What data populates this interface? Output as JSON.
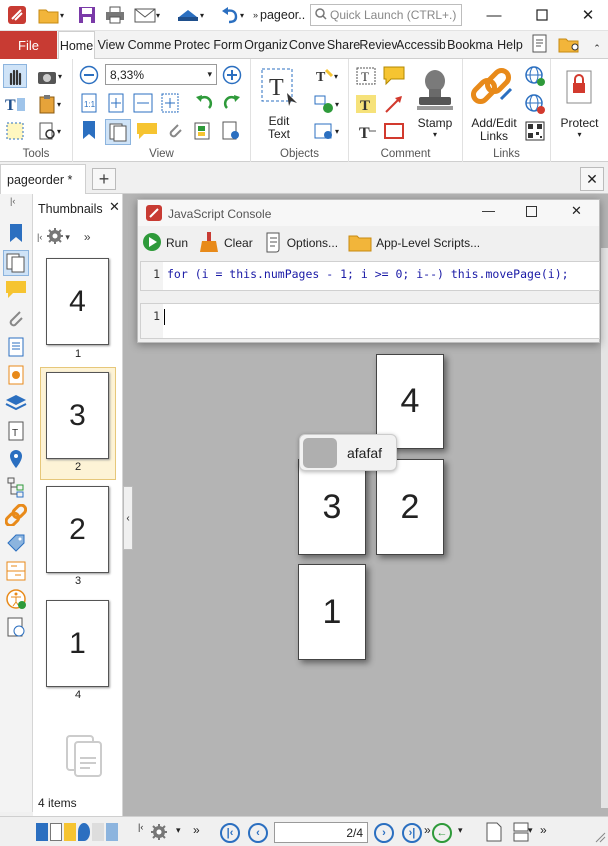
{
  "window": {
    "title": "pageor..",
    "search_placeholder": "Quick Launch (CTRL+.)"
  },
  "menu": {
    "file": "File",
    "tabs": [
      "Home",
      "View",
      "Comme",
      "Protec",
      "Form",
      "Organiz",
      "Conve",
      "Share",
      "Reviev",
      "Accessib",
      "Bookma",
      "Help"
    ]
  },
  "ribbon": {
    "zoom_value": "8,33%",
    "groups": {
      "tools": "Tools",
      "view": "View",
      "objects": "Objects",
      "comment": "Comment",
      "links": "Links"
    },
    "edit_text": "Edit\nText",
    "stamp": "Stamp",
    "add_edit_links": "Add/Edit\nLinks",
    "protect": "Protect"
  },
  "document_tab": {
    "label": "pageorder *"
  },
  "thumbnails": {
    "title": "Thumbnails",
    "items": [
      {
        "page_text": "4",
        "label": "1"
      },
      {
        "page_text": "3",
        "label": "2"
      },
      {
        "page_text": "2",
        "label": "3"
      },
      {
        "page_text": "1",
        "label": "4"
      }
    ],
    "count": "4 items"
  },
  "console": {
    "title": "JavaScript Console",
    "run": "Run",
    "clear": "Clear",
    "options": "Options...",
    "app_level": "App-Level Scripts...",
    "line1_no": "1",
    "code": "for (i = this.numPages - 1; i >= 0; i--) this.movePage(i);",
    "out_line_no": "1",
    "output": ""
  },
  "canvas_pages": [
    "4",
    "3",
    "2",
    "1"
  ],
  "tooltip": {
    "text": "afafaf"
  },
  "status": {
    "page_indicator": "2/4"
  },
  "colors": {
    "file_tab": "#c83b33",
    "nav_blue": "#2b6fc0",
    "canvas": "#b4b4b4"
  }
}
